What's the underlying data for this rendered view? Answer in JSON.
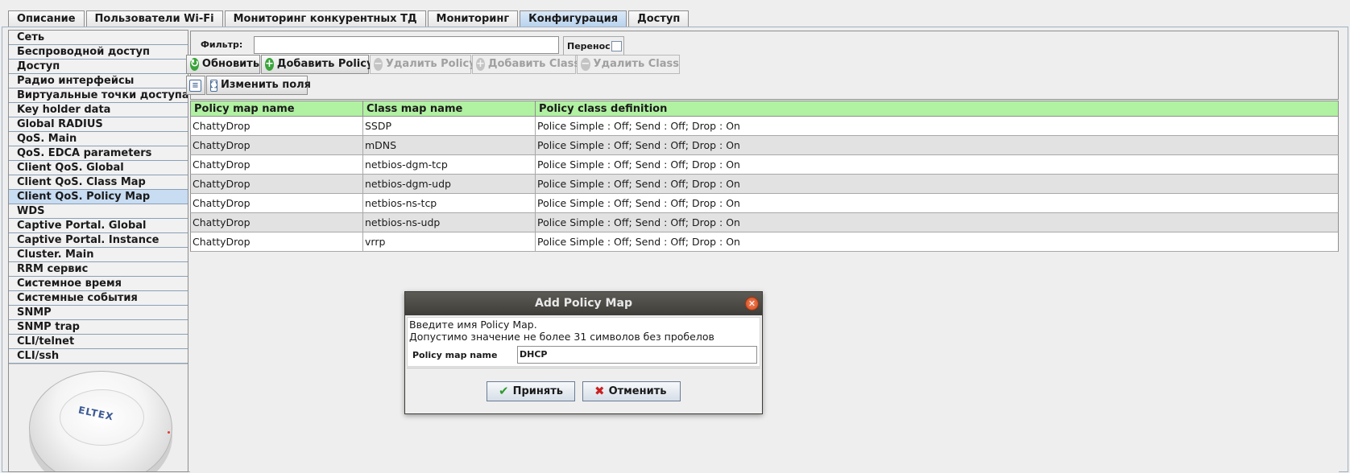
{
  "tabs": [
    "Описание",
    "Пользователи Wi-Fi",
    "Мониторинг конкурентных ТД",
    "Мониторинг",
    "Конфигурация",
    "Доступ"
  ],
  "active_tab": "Конфигурация",
  "sidebar": {
    "items": [
      "Сеть",
      "Беспроводной доступ",
      "Доступ",
      "Радио интерфейсы",
      "Виртуальные точки доступа",
      "Key holder data",
      "Global RADIUS",
      "QoS. Main",
      "QoS. EDCA parameters",
      "Client QoS. Global",
      "Client QoS. Class Map",
      "Client QoS. Policy Map",
      "WDS",
      "Captive Portal. Global",
      "Captive Portal. Instance",
      "Cluster. Main",
      "RRM сервис",
      "Системное время",
      "Системные события",
      "SNMP",
      "SNMP trap",
      "CLI/telnet",
      "CLI/ssh"
    ],
    "selected": "Client QoS. Policy Map",
    "device_logo": "ELTEX"
  },
  "toolbar": {
    "filter_label": "Фильтр:",
    "filter_value": "",
    "wrap_label": "Перенос",
    "refresh": "Обновить",
    "add_policy": "Добавить Policy",
    "delete_policy": "Удалить Policy",
    "add_class": "Добавить Class",
    "delete_class": "Удалить Class",
    "edit_fields": "Изменить поля"
  },
  "table": {
    "headers": [
      "Policy map name",
      "Class map name",
      "Policy class definition"
    ],
    "rows": [
      [
        "ChattyDrop",
        "SSDP",
        "Police Simple : Off; Send : Off; Drop : On"
      ],
      [
        "ChattyDrop",
        "mDNS",
        "Police Simple : Off; Send : Off; Drop : On"
      ],
      [
        "ChattyDrop",
        "netbios-dgm-tcp",
        "Police Simple : Off; Send : Off; Drop : On"
      ],
      [
        "ChattyDrop",
        "netbios-dgm-udp",
        "Police Simple : Off; Send : Off; Drop : On"
      ],
      [
        "ChattyDrop",
        "netbios-ns-tcp",
        "Police Simple : Off; Send : Off; Drop : On"
      ],
      [
        "ChattyDrop",
        "netbios-ns-udp",
        "Police Simple : Off; Send : Off; Drop : On"
      ],
      [
        "ChattyDrop",
        "vrrp",
        "Police Simple : Off; Send : Off; Drop : On"
      ]
    ],
    "header_color": "#b1f1a2"
  },
  "dialog": {
    "title": "Add Policy Map",
    "line1": "Введите имя Policy Map.",
    "line2": "Допустимо значение не более 31 символов без пробелов",
    "field_label": "Policy map name",
    "field_value": "DHCP",
    "ok": "Принять",
    "cancel": "Отменить"
  }
}
